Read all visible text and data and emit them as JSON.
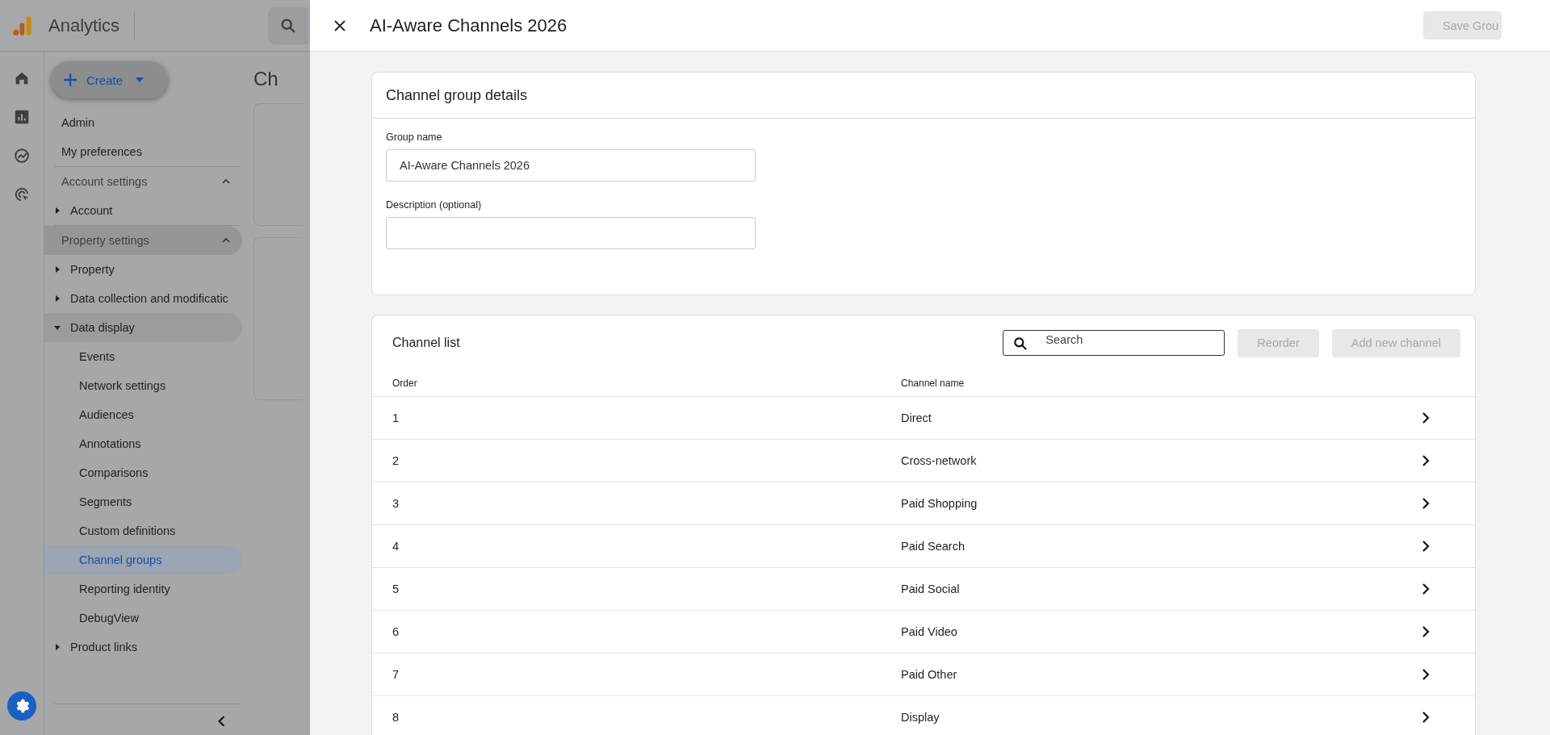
{
  "app": {
    "name": "Analytics"
  },
  "page": {
    "title_fragment": "Ch"
  },
  "sidebar": {
    "create_button": "Create",
    "links": [
      {
        "label": "Admin"
      },
      {
        "label": "My preferences"
      }
    ],
    "sections": [
      {
        "title": "Account settings",
        "expanded": true,
        "selected": false,
        "groups": [
          {
            "label": "Account",
            "expanded": false
          }
        ]
      },
      {
        "title": "Property settings",
        "expanded": true,
        "selected": true,
        "groups": [
          {
            "label": "Property",
            "expanded": false
          },
          {
            "label": "Data collection and modificatic",
            "expanded": false
          },
          {
            "label": "Data display",
            "expanded": true,
            "children": [
              {
                "label": "Events",
                "selected": false
              },
              {
                "label": "Network settings",
                "selected": false
              },
              {
                "label": "Audiences",
                "selected": false
              },
              {
                "label": "Annotations",
                "selected": false
              },
              {
                "label": "Comparisons",
                "selected": false
              },
              {
                "label": "Segments",
                "selected": false
              },
              {
                "label": "Custom definitions",
                "selected": false
              },
              {
                "label": "Channel groups",
                "selected": true
              },
              {
                "label": "Reporting identity",
                "selected": false
              },
              {
                "label": "DebugView",
                "selected": false
              }
            ]
          },
          {
            "label": "Product links",
            "expanded": false
          }
        ]
      }
    ]
  },
  "panel": {
    "title": "AI-Aware Channels 2026",
    "save_button": {
      "label": "Save Grou",
      "disabled": true
    },
    "details": {
      "title": "Channel group details",
      "fields": [
        {
          "label": "Group name",
          "value": "AI-Aware Channels 2026"
        },
        {
          "label": "Description (optional)"
        }
      ]
    },
    "channel_list": {
      "title": "Channel list",
      "search": {
        "placeholder": "Search"
      },
      "buttons": [
        {
          "label": "Reorder",
          "disabled": true
        },
        {
          "label": "Add new channel",
          "disabled": true
        }
      ],
      "columns": [
        "Order",
        "Channel name"
      ],
      "rows": [
        {
          "order": "1",
          "name": "Direct"
        },
        {
          "order": "2",
          "name": "Cross-network"
        },
        {
          "order": "3",
          "name": "Paid Shopping"
        },
        {
          "order": "4",
          "name": "Paid Search"
        },
        {
          "order": "5",
          "name": "Paid Social"
        },
        {
          "order": "6",
          "name": "Paid Video"
        },
        {
          "order": "7",
          "name": "Paid Other"
        },
        {
          "order": "8",
          "name": "Display"
        }
      ]
    }
  }
}
